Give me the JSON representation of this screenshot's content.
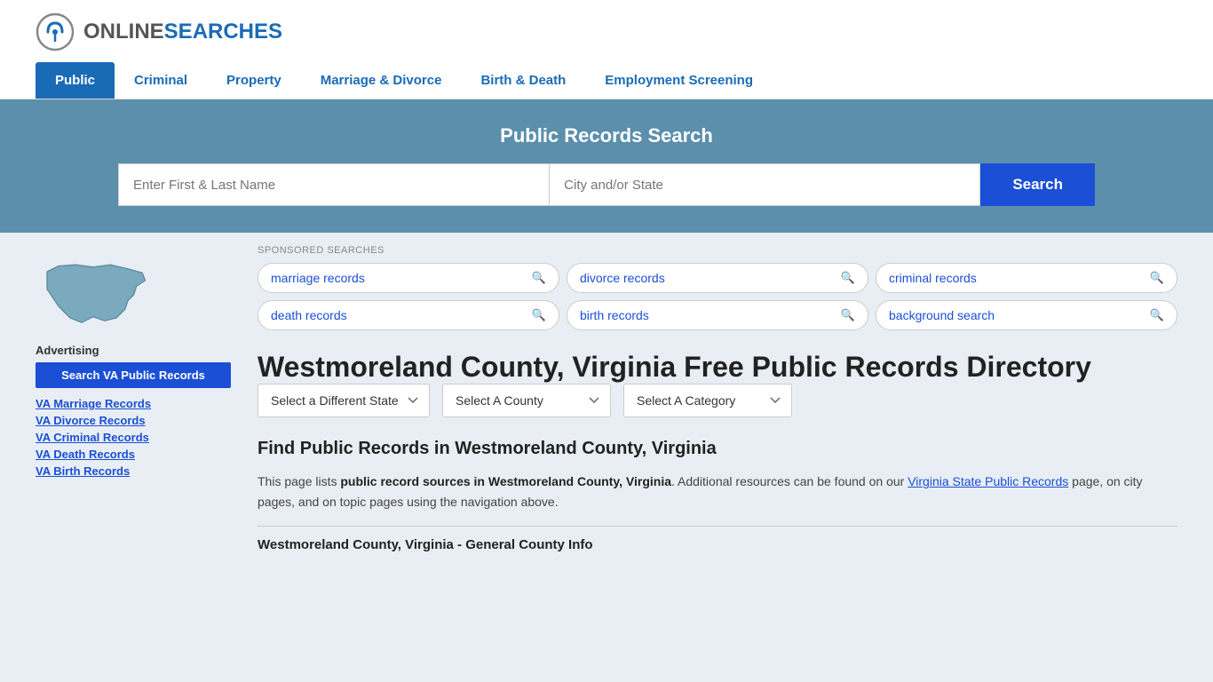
{
  "header": {
    "logo_text_online": "ONLINE",
    "logo_text_searches": "SEARCHES",
    "nav_items": [
      {
        "label": "Public",
        "active": true
      },
      {
        "label": "Criminal",
        "active": false
      },
      {
        "label": "Property",
        "active": false
      },
      {
        "label": "Marriage & Divorce",
        "active": false
      },
      {
        "label": "Birth & Death",
        "active": false
      },
      {
        "label": "Employment Screening",
        "active": false
      }
    ]
  },
  "hero": {
    "title": "Public Records Search",
    "name_placeholder": "Enter First & Last Name",
    "city_placeholder": "City and/or State",
    "search_label": "Search"
  },
  "sponsored": {
    "label": "SPONSORED SEARCHES",
    "items": [
      "marriage records",
      "divorce records",
      "criminal records",
      "death records",
      "birth records",
      "background search"
    ]
  },
  "page": {
    "title": "Westmoreland County, Virginia Free Public Records Directory",
    "dropdowns": {
      "state_label": "Select a Different State",
      "county_label": "Select A County",
      "category_label": "Select A Category"
    },
    "find_heading": "Find Public Records in Westmoreland County, Virginia",
    "description_part1": "This page lists ",
    "description_bold": "public record sources in Westmoreland County, Virginia",
    "description_part2": ". Additional resources can be found on our ",
    "description_link": "Virginia State Public Records",
    "description_part3": " page, on city pages, and on topic pages using the navigation above.",
    "sub_heading": "Westmoreland County, Virginia - General County Info"
  },
  "sidebar": {
    "advertising_label": "Advertising",
    "ad_button_label": "Search VA Public Records",
    "links": [
      "VA Marriage Records",
      "VA Divorce Records",
      "VA Criminal Records",
      "VA Death Records",
      "VA Birth Records"
    ]
  }
}
